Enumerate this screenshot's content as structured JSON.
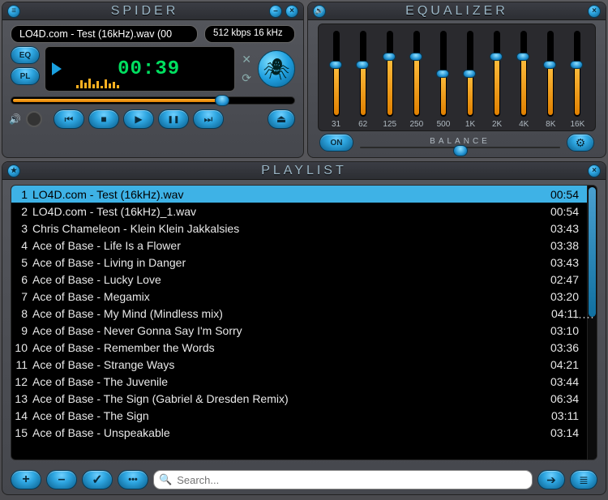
{
  "player": {
    "title": "SPIDER",
    "now_playing": "LO4D.com - Test (16kHz).wav (00",
    "bitrate_info": "512 kbps 16 kHz",
    "eq_label": "EQ",
    "pl_label": "PL",
    "timer": "00:39",
    "seek_pct": 72,
    "buttons": {
      "menu_glyph": "≡",
      "minimize_glyph": "–",
      "close_glyph": "×",
      "shuffle_glyph": "✕",
      "repeat_glyph": "⟳",
      "prev_glyph": "⏮",
      "stop_glyph": "■",
      "play_glyph": "▶",
      "pause_glyph": "❚❚",
      "next_glyph": "⏭",
      "eject_glyph": "⏏",
      "volume_glyph": "🔊",
      "logo_glyph": "🕷"
    }
  },
  "equalizer": {
    "title": "EQUALIZER",
    "speaker_glyph": "🔊",
    "close_glyph": "×",
    "on_label": "ON",
    "balance_label": "BALANCE",
    "balance_pct": 50,
    "preset_glyph": "⚙",
    "bands": [
      {
        "label": "31",
        "value": 60
      },
      {
        "label": "62",
        "value": 60
      },
      {
        "label": "125",
        "value": 70
      },
      {
        "label": "250",
        "value": 70
      },
      {
        "label": "500",
        "value": 50
      },
      {
        "label": "1K",
        "value": 50
      },
      {
        "label": "2K",
        "value": 70
      },
      {
        "label": "4K",
        "value": 70
      },
      {
        "label": "8K",
        "value": 60
      },
      {
        "label": "16K",
        "value": 60
      }
    ]
  },
  "playlist": {
    "title": "PLAYLIST",
    "star_glyph": "★",
    "close_glyph": "×",
    "tracks": [
      {
        "n": 1,
        "name": "LO4D.com - Test (16kHz).wav",
        "dur": "00:54",
        "selected": true
      },
      {
        "n": 2,
        "name": "LO4D.com - Test (16kHz)_1.wav",
        "dur": "00:54"
      },
      {
        "n": 3,
        "name": "Chris Chameleon - Klein Klein Jakkalsies",
        "dur": "03:43"
      },
      {
        "n": 4,
        "name": "Ace of Base - Life Is a Flower",
        "dur": "03:38"
      },
      {
        "n": 5,
        "name": "Ace of Base - Living in Danger",
        "dur": "03:43"
      },
      {
        "n": 6,
        "name": "Ace of Base - Lucky Love",
        "dur": "02:47"
      },
      {
        "n": 7,
        "name": "Ace of Base - Megamix",
        "dur": "03:20"
      },
      {
        "n": 8,
        "name": "Ace of Base - My Mind (Mindless mix)",
        "dur": "04:11"
      },
      {
        "n": 9,
        "name": "Ace of Base - Never Gonna Say I'm Sorry",
        "dur": "03:10"
      },
      {
        "n": 10,
        "name": "Ace of Base - Remember the Words",
        "dur": "03:36"
      },
      {
        "n": 11,
        "name": "Ace of Base - Strange Ways",
        "dur": "04:21"
      },
      {
        "n": 12,
        "name": "Ace of Base - The Juvenile",
        "dur": "03:44"
      },
      {
        "n": 13,
        "name": "Ace of Base - The Sign (Gabriel & Dresden Remix)",
        "dur": "06:34"
      },
      {
        "n": 14,
        "name": "Ace of Base - The Sign",
        "dur": "03:11"
      },
      {
        "n": 15,
        "name": "Ace of Base - Unspeakable",
        "dur": "03:14"
      }
    ],
    "footer": {
      "add_glyph": "+",
      "remove_glyph": "–",
      "check_glyph": "✓",
      "more_glyph": "•••",
      "search_icon": "🔍",
      "search_placeholder": "Search...",
      "go_glyph": "➔",
      "list_glyph": "≣"
    }
  }
}
